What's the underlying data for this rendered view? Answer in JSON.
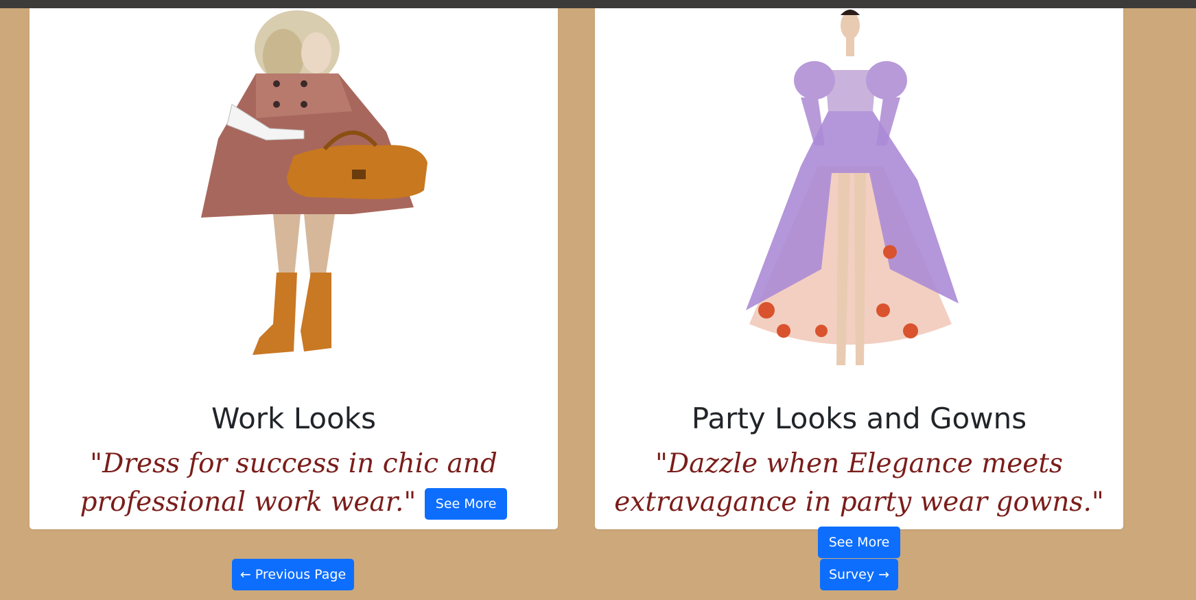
{
  "cards": [
    {
      "title": "Work Looks",
      "quote": "\"Dress for success in chic and professional work wear.\"",
      "button_label": "See More",
      "image_subject": "fashion-sketch-woman-cape-coat-handbag"
    },
    {
      "title": "Party Looks and Gowns",
      "quote": "\"Dazzle when Elegance meets extravagance in party wear gowns.\"",
      "button_label": "See More",
      "image_subject": "fashion-sketch-lavender-floral-gown"
    }
  ],
  "nav": {
    "previous_label": "← Previous Page",
    "next_label": "Survey →"
  },
  "colors": {
    "background": "#cda87a",
    "button": "#0d6efd",
    "quote": "#7a1d1a",
    "title": "#212529"
  }
}
